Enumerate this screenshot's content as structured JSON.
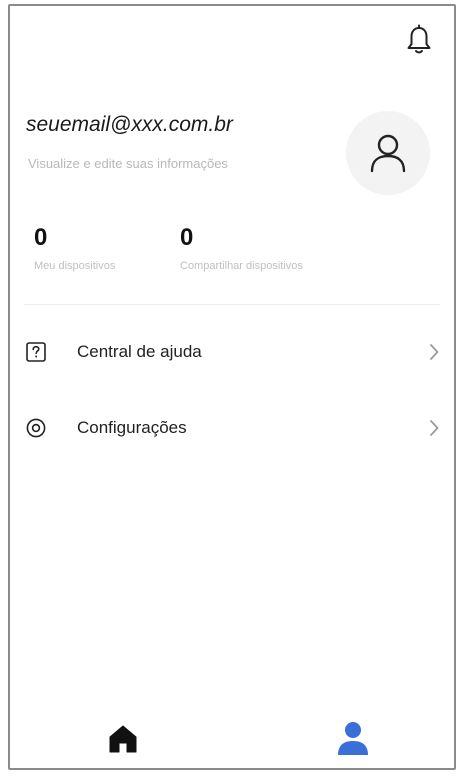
{
  "header": {
    "notifications_icon": "bell-icon"
  },
  "profile": {
    "email": "seuemail@xxx.com.br",
    "subtitle": "Visualize e edite suas informações",
    "avatar_icon": "user-icon"
  },
  "stats": [
    {
      "value": "0",
      "label": "Meu dispositivos"
    },
    {
      "value": "0",
      "label": "Compartilhar dispositivos"
    }
  ],
  "menu": [
    {
      "label": "Central de ajuda",
      "icon": "help-icon"
    },
    {
      "label": "Configurações",
      "icon": "settings-icon"
    }
  ],
  "tabbar": {
    "home_icon": "home-icon",
    "profile_icon": "profile-icon",
    "active_color": "#3a6fd8",
    "inactive_color": "#111111"
  }
}
